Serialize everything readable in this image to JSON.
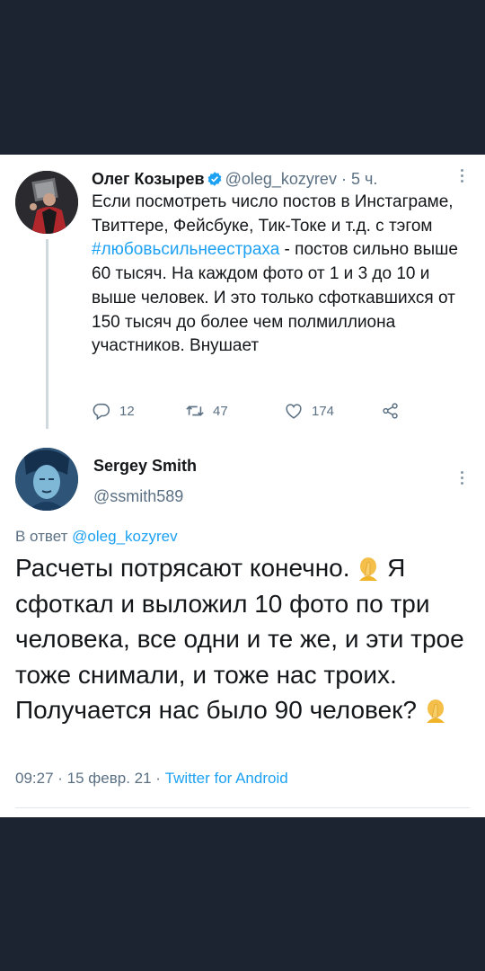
{
  "parent": {
    "name": "Олег Козырев",
    "handle": "@oleg_kozyrev",
    "time": "5 ч.",
    "text_before": "Если посмотреть число постов в Инстаграме, Твиттере, Фейсбуке, Тик-Токе и т.д. с тэгом ",
    "hashtag": "#любовьсильнеестраха",
    "text_after": " - постов сильно выше 60 тысяч. На каждом фото от 1 и 3 до 10 и выше человек. И это только сфоткавшихся от 150 тысяч до более чем полмиллиона участников. Внушает",
    "replies": "12",
    "retweets": "47",
    "likes": "174"
  },
  "reply": {
    "name": "Sergey Smith",
    "handle": "@ssmith589",
    "reply_prefix": "В ответ ",
    "reply_to": "@oleg_kozyrev",
    "text_1": "Расчеты потрясают конечно. ",
    "text_2": " Я сфоткал и выложил 10 фото по три человека, все одни и те же, и эти трое тоже снимали, и тоже нас троих. Получается нас было 90 человек? ",
    "time": "09:27",
    "date": "15 февр. 21",
    "source": "Twitter for Android"
  },
  "colors": {
    "background": "#1c2431",
    "link": "#1da1f2",
    "secondary": "#5b7083"
  },
  "icons": [
    "verified-icon",
    "more-icon",
    "reply-icon",
    "retweet-icon",
    "like-icon",
    "share-icon",
    "facepalm-emoji"
  ]
}
